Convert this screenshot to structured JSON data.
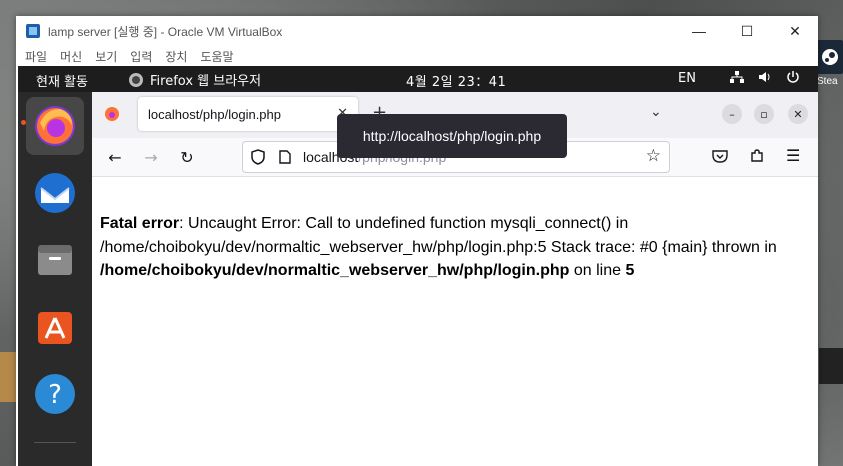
{
  "host": {
    "right_icon_label": "Stea"
  },
  "vbox": {
    "title": "lamp server [실행 중] - Oracle VM VirtualBox",
    "menu": [
      "파일",
      "머신",
      "보기",
      "입력",
      "장치",
      "도움말"
    ],
    "controls": {
      "minimize": "—",
      "maximize": "☐",
      "close": "✕"
    }
  },
  "ubuntu": {
    "topbar": {
      "activities": "현재 활동",
      "app_name": "Firefox 웹 브라우저",
      "clock": "4월 2일  23：41",
      "lang": "EN"
    },
    "dock": [
      {
        "name": "firefox",
        "icon": "firefox-icon"
      },
      {
        "name": "thunderbird",
        "icon": "thunderbird-icon"
      },
      {
        "name": "files",
        "icon": "files-icon"
      },
      {
        "name": "app-center",
        "icon": "app-center-icon"
      },
      {
        "name": "help",
        "icon": "help-icon"
      }
    ]
  },
  "firefox": {
    "tab_title": "localhost/php/login.php",
    "tooltip": "http://localhost/php/login.php",
    "url_host": "localhost",
    "url_path": "/php/login.php",
    "page": {
      "label": "Fatal error",
      "message": ": Uncaught Error: Call to undefined function mysqli_connect() in /home/choibokyu/dev/normaltic_webserver_hw/php/login.php:5 Stack trace: #0 {main} thrown in ",
      "file": "/home/choibokyu/dev/normaltic_webserver_hw/php/login.php",
      "online": " on line ",
      "line": "5"
    }
  }
}
